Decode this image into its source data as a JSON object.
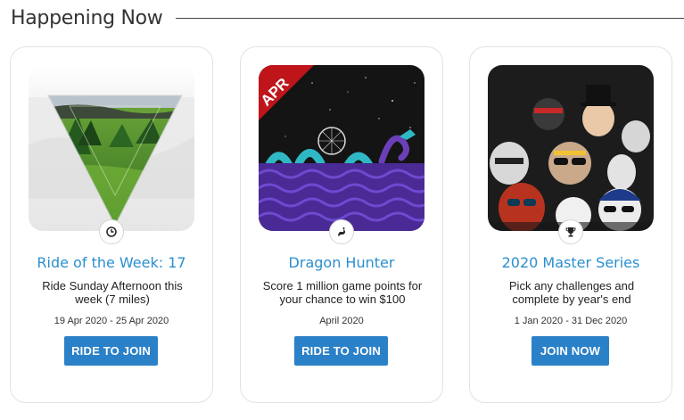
{
  "section": {
    "title": "Happening Now"
  },
  "cards": [
    {
      "title": "Ride of the Week: 17",
      "description": "Ride Sunday Afternoon this week (7 miles)",
      "date": "19 Apr 2020 - 25 Apr 2020",
      "button": "RIDE TO JOIN",
      "badge_icon": "clock-icon"
    },
    {
      "title": "Dragon Hunter",
      "description": "Score 1 million game points for your chance to win $100",
      "date": "April 2020",
      "button": "RIDE TO JOIN",
      "badge_icon": "dragon-icon",
      "ribbon": "APR"
    },
    {
      "title": "2020 Master Series",
      "description": "Pick any challenges and complete by year's end",
      "date": "1 Jan 2020 - 31 Dec 2020",
      "button": "JOIN NOW",
      "badge_icon": "trophy-icon"
    }
  ],
  "colors": {
    "link_blue": "#2a8fcf",
    "button_blue": "#2b81c8",
    "ribbon_red": "#c0141b"
  }
}
